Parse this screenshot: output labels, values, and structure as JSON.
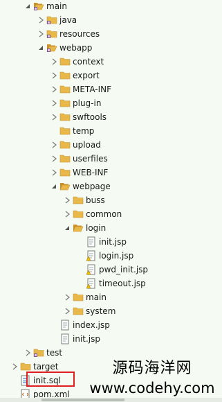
{
  "tree": [
    {
      "label": "main",
      "depth": 2,
      "expanded": true,
      "icon": "package-folder-icon",
      "open": true
    },
    {
      "label": "java",
      "depth": 3,
      "expanded": false,
      "icon": "package-folder-icon"
    },
    {
      "label": "resources",
      "depth": 3,
      "expanded": false,
      "icon": "package-folder-icon"
    },
    {
      "label": "webapp",
      "depth": 3,
      "expanded": true,
      "icon": "package-folder-icon",
      "open": true
    },
    {
      "label": "context",
      "depth": 4,
      "expanded": false,
      "icon": "folder-icon"
    },
    {
      "label": "export",
      "depth": 4,
      "expanded": false,
      "icon": "folder-icon"
    },
    {
      "label": "META-INF",
      "depth": 4,
      "expanded": false,
      "icon": "folder-icon"
    },
    {
      "label": "plug-in",
      "depth": 4,
      "expanded": false,
      "icon": "folder-icon"
    },
    {
      "label": "swftools",
      "depth": 4,
      "expanded": false,
      "icon": "folder-icon"
    },
    {
      "label": "temp",
      "depth": 4,
      "icon": "folder-icon"
    },
    {
      "label": "upload",
      "depth": 4,
      "expanded": false,
      "icon": "folder-icon"
    },
    {
      "label": "userfiles",
      "depth": 4,
      "expanded": false,
      "icon": "folder-icon"
    },
    {
      "label": "WEB-INF",
      "depth": 4,
      "expanded": false,
      "icon": "folder-icon"
    },
    {
      "label": "webpage",
      "depth": 4,
      "expanded": true,
      "icon": "folder-icon",
      "open": true
    },
    {
      "label": "buss",
      "depth": 5,
      "expanded": false,
      "icon": "folder-icon"
    },
    {
      "label": "common",
      "depth": 5,
      "expanded": false,
      "icon": "folder-icon"
    },
    {
      "label": "login",
      "depth": 5,
      "expanded": true,
      "icon": "folder-icon",
      "open": true
    },
    {
      "label": "init.jsp",
      "depth": 6,
      "icon": "jsp-file-icon"
    },
    {
      "label": "login.jsp",
      "depth": 6,
      "icon": "jsp-warning-file-icon"
    },
    {
      "label": "pwd_init.jsp",
      "depth": 6,
      "icon": "jsp-warning-file-icon"
    },
    {
      "label": "timeout.jsp",
      "depth": 6,
      "icon": "jsp-warning-file-icon"
    },
    {
      "label": "main",
      "depth": 5,
      "expanded": false,
      "icon": "folder-icon"
    },
    {
      "label": "system",
      "depth": 5,
      "expanded": false,
      "icon": "folder-icon"
    },
    {
      "label": "index.jsp",
      "depth": 4,
      "icon": "jsp-file-icon"
    },
    {
      "label": "init.jsp",
      "depth": 4,
      "icon": "jsp-file-icon"
    },
    {
      "label": "test",
      "depth": 2,
      "expanded": false,
      "icon": "package-folder-icon"
    },
    {
      "label": "target",
      "depth": 1,
      "expanded": false,
      "icon": "folder-icon"
    },
    {
      "label": "init.sql",
      "depth": 1,
      "icon": "sql-file-icon",
      "highlighted": true
    },
    {
      "label": "pom.xml",
      "depth": 1,
      "icon": "xml-file-icon"
    }
  ],
  "watermark": {
    "text_cn": "源码海洋网",
    "url": "www.codehy.com"
  },
  "colors": {
    "background": "#f5fbf2",
    "folder": "#e8b84a",
    "highlight_border": "#e02020"
  }
}
